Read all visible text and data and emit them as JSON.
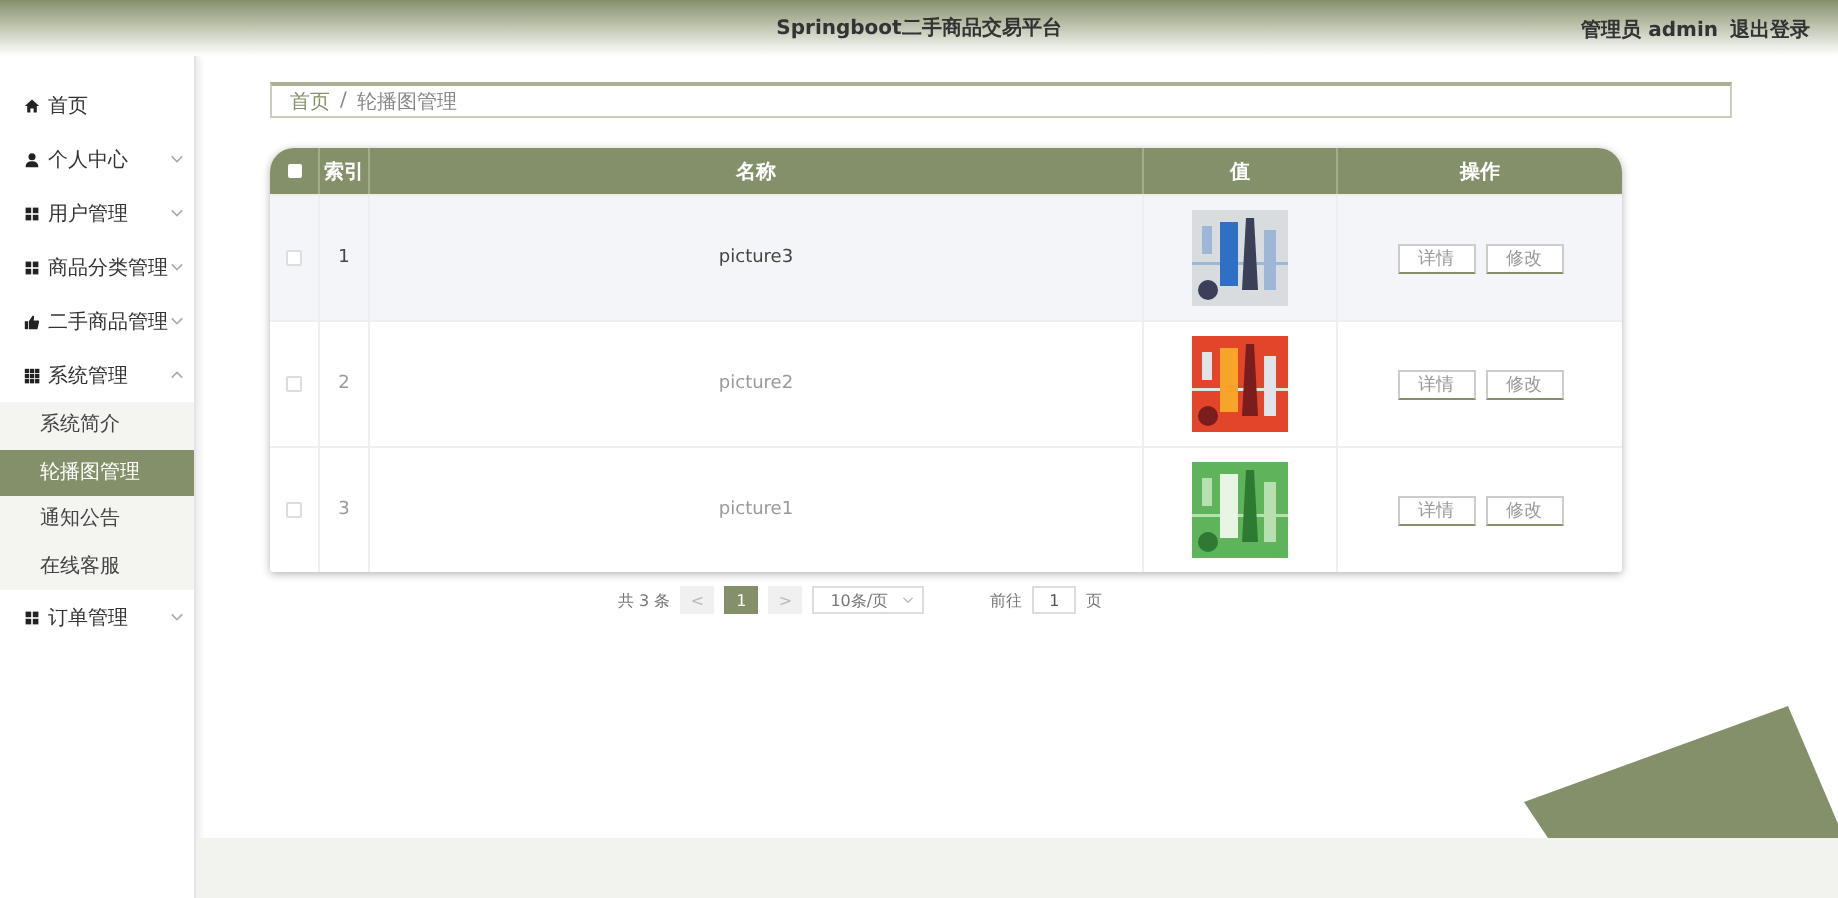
{
  "header": {
    "title": "Springboot二手商品交易平台",
    "user": "管理员 admin",
    "logout": "退出登录"
  },
  "sidebar": {
    "items": [
      {
        "label": "首页"
      },
      {
        "label": "个人中心",
        "expanded": false
      },
      {
        "label": "用户管理",
        "expanded": false
      },
      {
        "label": "商品分类管理",
        "expanded": false
      },
      {
        "label": "二手商品管理",
        "expanded": false
      },
      {
        "label": "系统管理",
        "expanded": true,
        "children": [
          {
            "label": "系统简介",
            "selected": false
          },
          {
            "label": "轮播图管理",
            "selected": true
          },
          {
            "label": "通知公告",
            "selected": false
          },
          {
            "label": "在线客服",
            "selected": false
          }
        ]
      },
      {
        "label": "订单管理",
        "expanded": false
      }
    ]
  },
  "breadcrumb": {
    "items": [
      "首页",
      "轮播图管理"
    ],
    "separator": "/"
  },
  "table": {
    "select_all_checked": false,
    "columns": [
      "索引",
      "名称",
      "值",
      "操作"
    ],
    "rows": [
      {
        "checked": false,
        "index": "1",
        "name": "picture3",
        "hovered": true,
        "actions": [
          "详情",
          "修改"
        ]
      },
      {
        "checked": false,
        "index": "2",
        "name": "picture2",
        "hovered": false,
        "actions": [
          "详情",
          "修改"
        ]
      },
      {
        "checked": false,
        "index": "3",
        "name": "picture1",
        "hovered": false,
        "actions": [
          "详情",
          "修改"
        ]
      }
    ]
  },
  "pagination": {
    "total": "共 3 条",
    "prev": "<",
    "pages": [
      {
        "label": "1",
        "selected": true
      }
    ],
    "next": ">",
    "page_size": "10条/页",
    "goto": "前往",
    "goto_value": "1",
    "page_unit": "页"
  }
}
